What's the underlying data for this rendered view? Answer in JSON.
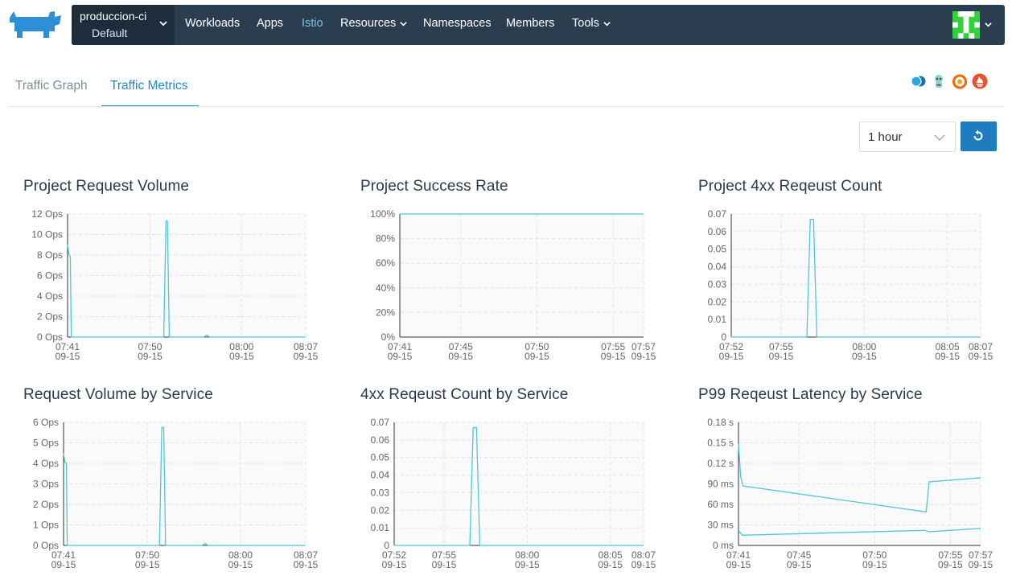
{
  "header": {
    "cluster_name": "produccion-ci",
    "project_name": "Default",
    "nav": [
      {
        "label": "Workloads",
        "active": false,
        "has_menu": false
      },
      {
        "label": "Apps",
        "active": false,
        "has_menu": false
      },
      {
        "label": "Istio",
        "active": true,
        "has_menu": false
      },
      {
        "label": "Resources",
        "active": false,
        "has_menu": true
      },
      {
        "label": "Namespaces",
        "active": false,
        "has_menu": false
      },
      {
        "label": "Members",
        "active": false,
        "has_menu": false
      },
      {
        "label": "Tools",
        "active": false,
        "has_menu": true
      }
    ],
    "icons": [
      "rancher-logo-icon",
      "chevron-down-icon",
      "user-avatar-icon"
    ]
  },
  "tabs": [
    {
      "label": "Traffic Graph",
      "active": false
    },
    {
      "label": "Traffic Metrics",
      "active": true
    }
  ],
  "tool_icons": [
    "kiali-icon",
    "jaeger-icon",
    "grafana-icon",
    "prometheus-icon"
  ],
  "controls": {
    "time_range": "1 hour",
    "refresh_icon": "refresh-icon"
  },
  "colors": {
    "navbar": "#2b3e50",
    "accent": "#1f89c9",
    "line": "#4ec8d8"
  },
  "chart_data": [
    {
      "title": "Project Request Volume",
      "type": "line",
      "y_ticks": [
        "12 Ops",
        "10 Ops",
        "8 Ops",
        "6 Ops",
        "4 Ops",
        "2 Ops",
        "0 Ops"
      ],
      "ylim": [
        0,
        12
      ],
      "x_ticks": [
        {
          "time": "07:41",
          "date": "09-15",
          "t": 0
        },
        {
          "time": "07:50",
          "date": "09-15",
          "t": 9
        },
        {
          "time": "08:00",
          "date": "09-15",
          "t": 19
        },
        {
          "time": "08:07",
          "date": "09-15",
          "t": 26
        }
      ],
      "xlim": [
        0,
        26
      ],
      "series": [
        {
          "points": [
            [
              0,
              9
            ],
            [
              0.15,
              8.1
            ],
            [
              0.3,
              7.8
            ],
            [
              0.4,
              0
            ],
            [
              10.5,
              0
            ],
            [
              10.75,
              11.3
            ],
            [
              10.9,
              11.3
            ],
            [
              11.1,
              0
            ],
            [
              14.9,
              0
            ],
            [
              15.2,
              0.2
            ],
            [
              15.5,
              0
            ],
            [
              26,
              0
            ]
          ]
        }
      ]
    },
    {
      "title": "Project Success Rate",
      "type": "line",
      "y_ticks": [
        "100%",
        "80%",
        "60%",
        "40%",
        "20%",
        "0%"
      ],
      "ylim": [
        0,
        100
      ],
      "x_ticks": [
        {
          "time": "07:41",
          "date": "09-15",
          "t": 0
        },
        {
          "time": "07:45",
          "date": "09-15",
          "t": 4
        },
        {
          "time": "07:50",
          "date": "09-15",
          "t": 9
        },
        {
          "time": "07:55",
          "date": "09-15",
          "t": 14
        },
        {
          "time": "07:57",
          "date": "09-15",
          "t": 16
        }
      ],
      "xlim": [
        0,
        16
      ],
      "series": [
        {
          "points": [
            [
              0,
              100
            ],
            [
              16,
              100
            ]
          ]
        }
      ]
    },
    {
      "title": "Project 4xx Reqeust Count",
      "type": "line",
      "y_ticks": [
        "0.07",
        "0.06",
        "0.05",
        "0.04",
        "0.03",
        "0.02",
        "0.01",
        "0"
      ],
      "ylim": [
        0,
        0.07
      ],
      "x_ticks": [
        {
          "time": "07:52",
          "date": "09-15",
          "t": 0
        },
        {
          "time": "07:55",
          "date": "09-15",
          "t": 3
        },
        {
          "time": "08:00",
          "date": "09-15",
          "t": 8
        },
        {
          "time": "08:05",
          "date": "09-15",
          "t": 13
        },
        {
          "time": "08:07",
          "date": "09-15",
          "t": 15
        }
      ],
      "xlim": [
        0,
        15
      ],
      "series": [
        {
          "points": [
            [
              0,
              0
            ],
            [
              4.55,
              0
            ],
            [
              4.75,
              0.067
            ],
            [
              4.95,
              0.067
            ],
            [
              5.15,
              0
            ],
            [
              15,
              0
            ]
          ]
        }
      ]
    },
    {
      "title": "Request Volume by Service",
      "type": "line",
      "y_ticks": [
        "6 Ops",
        "5 Ops",
        "4 Ops",
        "3 Ops",
        "2 Ops",
        "1 Ops",
        "0 Ops"
      ],
      "ylim": [
        0,
        6
      ],
      "x_ticks": [
        {
          "time": "07:41",
          "date": "09-15",
          "t": 0
        },
        {
          "time": "07:50",
          "date": "09-15",
          "t": 9
        },
        {
          "time": "08:00",
          "date": "09-15",
          "t": 19
        },
        {
          "time": "08:07",
          "date": "09-15",
          "t": 26
        }
      ],
      "xlim": [
        0,
        26
      ],
      "series": [
        {
          "points": [
            [
              0,
              4.5
            ],
            [
              0.15,
              4.05
            ],
            [
              0.3,
              4.0
            ],
            [
              0.4,
              0
            ],
            [
              10.3,
              0
            ],
            [
              10.55,
              5.75
            ],
            [
              10.75,
              5.75
            ],
            [
              10.95,
              0
            ],
            [
              14.9,
              0
            ],
            [
              15.2,
              0.1
            ],
            [
              15.5,
              0
            ],
            [
              26,
              0
            ]
          ]
        }
      ]
    },
    {
      "title": "4xx Reqeust Count by Service",
      "type": "line",
      "y_ticks": [
        "0.07",
        "0.06",
        "0.05",
        "0.04",
        "0.03",
        "0.02",
        "0.01",
        "0"
      ],
      "ylim": [
        0,
        0.07
      ],
      "x_ticks": [
        {
          "time": "07:52",
          "date": "09-15",
          "t": 0
        },
        {
          "time": "07:55",
          "date": "09-15",
          "t": 3
        },
        {
          "time": "08:00",
          "date": "09-15",
          "t": 8
        },
        {
          "time": "08:05",
          "date": "09-15",
          "t": 13
        },
        {
          "time": "08:07",
          "date": "09-15",
          "t": 15
        }
      ],
      "xlim": [
        0,
        15
      ],
      "series": [
        {
          "points": [
            [
              0,
              0
            ],
            [
              4.55,
              0
            ],
            [
              4.75,
              0.067
            ],
            [
              4.95,
              0.067
            ],
            [
              5.15,
              0
            ],
            [
              15,
              0
            ]
          ]
        }
      ]
    },
    {
      "title": "P99 Reqeust Latency by Service",
      "type": "line",
      "y_ticks": [
        "0.18 s",
        "0.15 s",
        "0.12 s",
        "90 ms",
        "60 ms",
        "30 ms",
        "0 ms"
      ],
      "ylim": [
        0,
        180
      ],
      "x_ticks": [
        {
          "time": "07:41",
          "date": "09-15",
          "t": 0
        },
        {
          "time": "07:45",
          "date": "09-15",
          "t": 4
        },
        {
          "time": "07:50",
          "date": "09-15",
          "t": 9
        },
        {
          "time": "07:55",
          "date": "09-15",
          "t": 14
        },
        {
          "time": "07:57",
          "date": "09-15",
          "t": 16
        }
      ],
      "xlim": [
        0,
        16
      ],
      "series": [
        {
          "points": [
            [
              0,
              148
            ],
            [
              0.15,
              100
            ],
            [
              0.3,
              87
            ],
            [
              12.4,
              49
            ],
            [
              12.6,
              93
            ],
            [
              16,
              99
            ]
          ]
        },
        {
          "points": [
            [
              0,
              22
            ],
            [
              0.25,
              15
            ],
            [
              12.3,
              22
            ],
            [
              12.6,
              20
            ],
            [
              16,
              25
            ]
          ]
        }
      ]
    }
  ]
}
